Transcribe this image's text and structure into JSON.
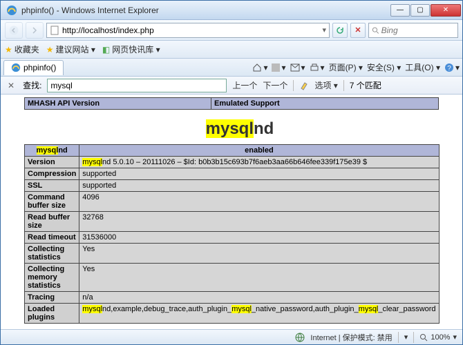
{
  "window": {
    "title": "phpinfo() - Windows Internet Explorer"
  },
  "nav": {
    "url": "http://localhost/index.php"
  },
  "search": {
    "placeholder": "Bing"
  },
  "favbar": {
    "favorites": "收藏夹",
    "suggested": "建议网站 ▾",
    "slice": "网页快讯库 ▾"
  },
  "tab": {
    "label": "phpinfo()"
  },
  "toolbar": {
    "page": "页面(P) ▾",
    "safety": "安全(S) ▾",
    "tools": "工具(O) ▾"
  },
  "findbar": {
    "label": "查找:",
    "value": "mysql",
    "prev": "上一个",
    "next": "下一个",
    "options": "选项 ▾",
    "matches": "7 个匹配"
  },
  "topTable": {
    "left": "MHASH API Version",
    "right": "Emulated Support"
  },
  "section": {
    "title_hl": "mysql",
    "title_rest": "nd"
  },
  "tbl": {
    "h1_hl": "mysql",
    "h1_rest": "nd",
    "h2": "enabled",
    "r1k": "Version",
    "r1_hl": "mysql",
    "r1_rest": "nd 5.0.10 – 20111026 – $Id: b0b3b15c693b7f6aeb3aa66b646fee339f175e39 $",
    "r2k": "Compression",
    "r2v": "supported",
    "r3k": "SSL",
    "r3v": "supported",
    "r4k": "Command buffer size",
    "r4v": "4096",
    "r5k": "Read buffer size",
    "r5v": "32768",
    "r6k": "Read timeout",
    "r6v": "31536000",
    "r7k": "Collecting statistics",
    "r7v": "Yes",
    "r8k": "Collecting memory statistics",
    "r8v": "Yes",
    "r9k": "Tracing",
    "r9v": "n/a",
    "r10k": "Loaded plugins",
    "r10_a_hl": "mysql",
    "r10_a_rest": "nd,example,debug_trace,auth_plugin_",
    "r10_b_hl": "mysql",
    "r10_b_rest": "_native_password,auth_plugin_",
    "r10_c_hl": "mysql",
    "r10_c_rest": "_clear_password"
  },
  "status": {
    "internet": "Internet | 保护模式: 禁用",
    "zoom": "100%"
  }
}
